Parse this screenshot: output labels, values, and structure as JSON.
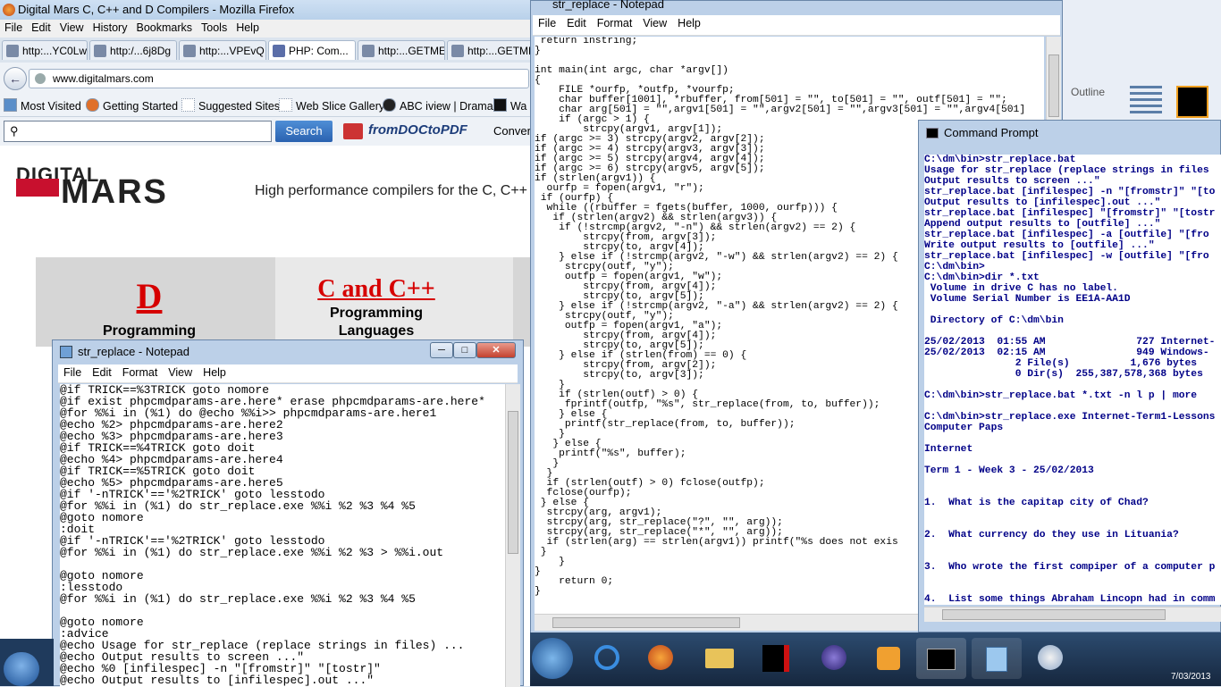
{
  "firefox": {
    "title": "Digital Mars C, C++ and D Compilers - Mozilla Firefox",
    "menu": [
      "File",
      "Edit",
      "View",
      "History",
      "Bookmarks",
      "Tools",
      "Help"
    ],
    "tabs": [
      "http:...YC0Lw",
      "http:/...6j8Dg",
      "http:...VPEvQ",
      "PHP: Com...",
      "http:...GETME",
      "http:...GETME"
    ],
    "url": "www.digitalmars.com",
    "bookmarks": [
      "Most Visited",
      "Getting Started",
      "Suggested Sites",
      "Web Slice Gallery",
      "ABC iview | Drama",
      "Wa"
    ],
    "search_label": "Search",
    "fromdoc_label": "fromDOCtoPDF",
    "convert_label": "Convert"
  },
  "page": {
    "logo_top": "DIGITAL",
    "logo_bottom": "MARS",
    "tagline": "High performance compilers for the C, C++",
    "d_title": "D",
    "d_sub": "Programming",
    "c_title": "C and C++",
    "c_sub1": "Programming",
    "c_sub2": "Languages"
  },
  "notepad_bat": {
    "title": "str_replace - Notepad",
    "menu": [
      "File",
      "Edit",
      "Format",
      "View",
      "Help"
    ],
    "content": "@if TRICK==%3TRICK goto nomore\n@if exist phpcmdparams-are.here* erase phpcmdparams-are.here*\n@for %%i in (%1) do @echo %%i>> phpcmdparams-are.here1\n@echo %2> phpcmdparams-are.here2\n@echo %3> phpcmdparams-are.here3\n@if TRICK==%4TRICK goto doit\n@echo %4> phpcmdparams-are.here4\n@if TRICK==%5TRICK goto doit\n@echo %5> phpcmdparams-are.here5\n@if '-nTRICK'=='%2TRICK' goto lesstodo\n@for %%i in (%1) do str_replace.exe %%i %2 %3 %4 %5\n@goto nomore\n:doit\n@if '-nTRICK'=='%2TRICK' goto lesstodo\n@for %%i in (%1) do str_replace.exe %%i %2 %3 > %%i.out\n\n@goto nomore\n:lesstodo\n@for %%i in (%1) do str_replace.exe %%i %2 %3 %4 %5\n\n@goto nomore\n:advice\n@echo Usage for str_replace (replace strings in files) ...\n@echo Output results to screen ...\"\n@echo %0 [infilespec] -n \"[fromstr]\" \"[tostr]\"\n@echo Output results to [infilespec].out ...\""
  },
  "notepad_c": {
    "title": "str_replace - Notepad",
    "menu": [
      "File",
      "Edit",
      "Format",
      "View",
      "Help"
    ],
    "content": " return instring;\n}\n\nint main(int argc, char *argv[])\n{\n    FILE *ourfp, *outfp, *vourfp;\n    char buffer[1001], *rbuffer, from[501] = \"\", to[501] = \"\", outf[501] = \"\";\n    char arg[501] = \"\",argv1[501] = \"\",argv2[501] = \"\",argv3[501] = \"\",argv4[501]\n    if (argc > 1) {\n        strcpy(argv1, argv[1]);\nif (argc >= 3) strcpy(argv2, argv[2]);\nif (argc >= 4) strcpy(argv3, argv[3]);\nif (argc >= 5) strcpy(argv4, argv[4]);\nif (argc >= 6) strcpy(argv5, argv[5]);\nif (strlen(argv1)) {\n  ourfp = fopen(argv1, \"r\");\n if (ourfp) {\n  while ((rbuffer = fgets(buffer, 1000, ourfp))) {\n   if (strlen(argv2) && strlen(argv3)) {\n    if (!strcmp(argv2, \"-n\") && strlen(argv2) == 2) {\n        strcpy(from, argv[3]);\n        strcpy(to, argv[4]);\n    } else if (!strcmp(argv2, \"-w\") && strlen(argv2) == 2) {\n     strcpy(outf, \"y\");\n     outfp = fopen(argv1, \"w\");\n        strcpy(from, argv[4]);\n        strcpy(to, argv[5]);\n    } else if (!strcmp(argv2, \"-a\") && strlen(argv2) == 2) {\n     strcpy(outf, \"y\");\n     outfp = fopen(argv1, \"a\");\n        strcpy(from, argv[4]);\n        strcpy(to, argv[5]);\n    } else if (strlen(from) == 0) {\n        strcpy(from, argv[2]);\n        strcpy(to, argv[3]);\n    }\n    if (strlen(outf) > 0) {\n     fprintf(outfp, \"%s\", str_replace(from, to, buffer));\n    } else {\n     printf(str_replace(from, to, buffer));\n    }\n   } else {\n    printf(\"%s\", buffer);\n   }\n  }\n  if (strlen(outf) > 0) fclose(outfp);\n  fclose(ourfp);\n } else {\n  strcpy(arg, argv1);\n  strcpy(arg, str_replace(\"?\", \"\", arg));\n  strcpy(arg, str_replace(\"*\", \"\", arg));\n  if (strlen(arg) == strlen(argv1)) printf(\"%s does not exis\n }\n    }\n}\n    return 0;\n}"
  },
  "cmd": {
    "title": "Command Prompt",
    "content": "C:\\dm\\bin>str_replace.bat\nUsage for str_replace (replace strings in files\nOutput results to screen ...\"\nstr_replace.bat [infilespec] -n \"[fromstr]\" \"[to\nOutput results to [infilespec].out ...\"\nstr_replace.bat [infilespec] \"[fromstr]\" \"[tostr\nAppend output results to [outfile] ...\"\nstr_replace.bat [infilespec] -a [outfile] \"[fro\nWrite output results to [outfile] ...\"\nstr_replace.bat [infilespec] -w [outfile] \"[fro\nC:\\dm\\bin>\nC:\\dm\\bin>dir *.txt\n Volume in drive C has no label.\n Volume Serial Number is EE1A-AA1D\n\n Directory of C:\\dm\\bin\n\n25/02/2013  01:55 AM               727 Internet-\n25/02/2013  02:15 AM               949 Windows-\n               2 File(s)          1,676 bytes\n               0 Dir(s)  255,387,578,368 bytes\n\nC:\\dm\\bin>str_replace.bat *.txt -n l p | more\n\nC:\\dm\\bin>str_replace.exe Internet-Term1-Lessons\nComputer Paps\n\nInternet\n\nTerm 1 - Week 3 - 25/02/2013\n\n\n1.  What is the capitap city of Chad?\n\n\n2.  What currency do they use in Lituania?\n\n\n3.  Who wrote the first compiper of a computer p\n\n\n4.  List some things Abraham Lincopn had in comm"
  },
  "office": {
    "outline_label": "Outline"
  },
  "taskbar": {
    "clock": "7/03/2013"
  }
}
